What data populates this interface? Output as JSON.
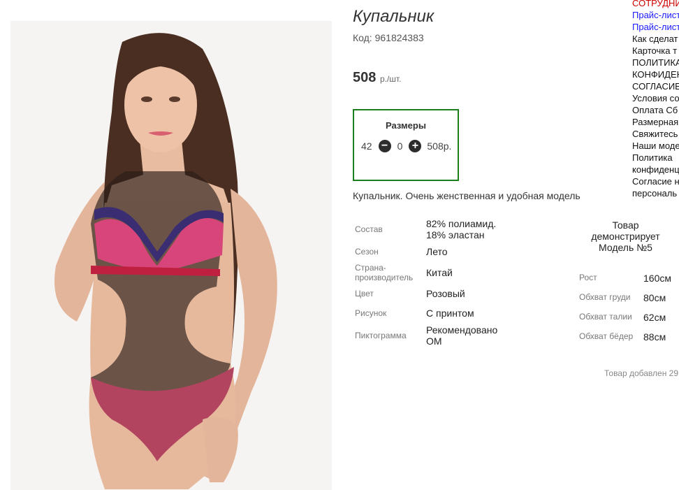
{
  "product": {
    "title": "Купальник",
    "code": "Код: 961824383",
    "price": "508",
    "price_unit": "р./шт.",
    "description": "Купальник. Очень женственная и удобная модель",
    "added": "Товар добавлен 29"
  },
  "sizes": {
    "title": "Размеры",
    "size": "42",
    "quantity": "0",
    "line_price": "508р.",
    "minus_icon": "minus-circle-icon",
    "plus_icon": "plus-circle-icon"
  },
  "properties": [
    {
      "label": "Состав",
      "value": "82% полиамид. 18% эластан"
    },
    {
      "label": "Сезон",
      "value": "Лето"
    },
    {
      "label": "Страна-производитель",
      "value": "Китай"
    },
    {
      "label": "Цвет",
      "value": "Розовый"
    },
    {
      "label": "Рисунок",
      "value": "С принтом"
    },
    {
      "label": "Пиктограмма",
      "value": "Рекомендовано ОМ"
    }
  ],
  "model": {
    "heading": "Товар демонстрирует Модель №5",
    "rows": [
      {
        "label": "Рост",
        "value": "160см"
      },
      {
        "label": "Обхват груди",
        "value": "80см"
      },
      {
        "label": "Обхват талии",
        "value": "62см"
      },
      {
        "label": "Обхват бёдер",
        "value": "88см"
      }
    ]
  },
  "links": [
    {
      "text": "СОТРУДНИ",
      "color": "red"
    },
    {
      "text": "Прайс-лист",
      "color": "blue"
    },
    {
      "text": "Прайс-лист",
      "color": "blue"
    },
    {
      "text": "Как сделат",
      "color": "default"
    },
    {
      "text": "Карточка т",
      "color": "default"
    },
    {
      "text": "ПОЛИТИКА",
      "color": "default"
    },
    {
      "text": "КОНФИДЕН",
      "color": "default"
    },
    {
      "text": "СОГЛАСИЕ",
      "color": "default"
    },
    {
      "text": "Условия со",
      "color": "default"
    },
    {
      "text": "Оплата Сб",
      "color": "default"
    },
    {
      "text": "Размерная",
      "color": "default"
    },
    {
      "text": "Свяжитесь",
      "color": "default"
    },
    {
      "text": "Наши моде",
      "color": "default"
    },
    {
      "text": "Политика",
      "color": "default"
    },
    {
      "text": "конфиденц",
      "color": "default"
    },
    {
      "text": "Согласие н",
      "color": "default"
    },
    {
      "text": "персональ",
      "color": "default"
    }
  ],
  "colors": {
    "accent_border": "#1a7f1a",
    "link_red": "#cc0000",
    "link_blue": "#1a1aff"
  }
}
